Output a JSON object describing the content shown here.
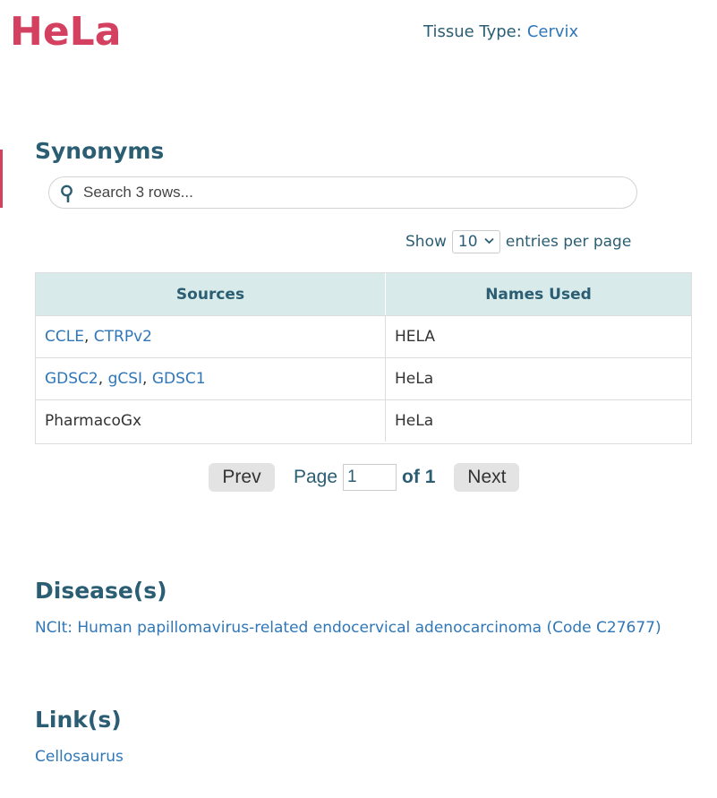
{
  "cell_line": {
    "name": "HeLa",
    "tissue_label": "Tissue Type:",
    "tissue_value": "Cervix"
  },
  "synonyms": {
    "heading": "Synonyms",
    "search_placeholder": "Search 3 rows...",
    "show_label": "Show",
    "entries_per_page": "10",
    "entries_suffix": "entries per page",
    "columns": [
      "Sources",
      "Names Used"
    ],
    "rows": [
      {
        "sources": [
          {
            "label": "CCLE",
            "link": true
          },
          {
            "label": "CTRPv2",
            "link": true
          }
        ],
        "name": "HELA"
      },
      {
        "sources": [
          {
            "label": "GDSC2",
            "link": true
          },
          {
            "label": "gCSI",
            "link": true
          },
          {
            "label": "GDSC1",
            "link": true
          }
        ],
        "name": "HeLa"
      },
      {
        "sources": [
          {
            "label": "PharmacoGx",
            "link": false
          }
        ],
        "name": "HeLa"
      }
    ],
    "pagination": {
      "prev_label": "Prev",
      "page_label": "Page",
      "current_page": "1",
      "of_label": "of 1",
      "next_label": "Next"
    }
  },
  "diseases": {
    "heading": "Disease(s)",
    "items": [
      "NCIt: Human papillomavirus-related endocervical adenocarcinoma (Code C27677)"
    ]
  },
  "links": {
    "heading": "Link(s)",
    "items": [
      "Cellosaurus"
    ]
  },
  "colors": {
    "title": "#d4405f",
    "heading": "#2b5e73",
    "link": "#2f77b8",
    "table_header_bg": "#d8eaea"
  }
}
